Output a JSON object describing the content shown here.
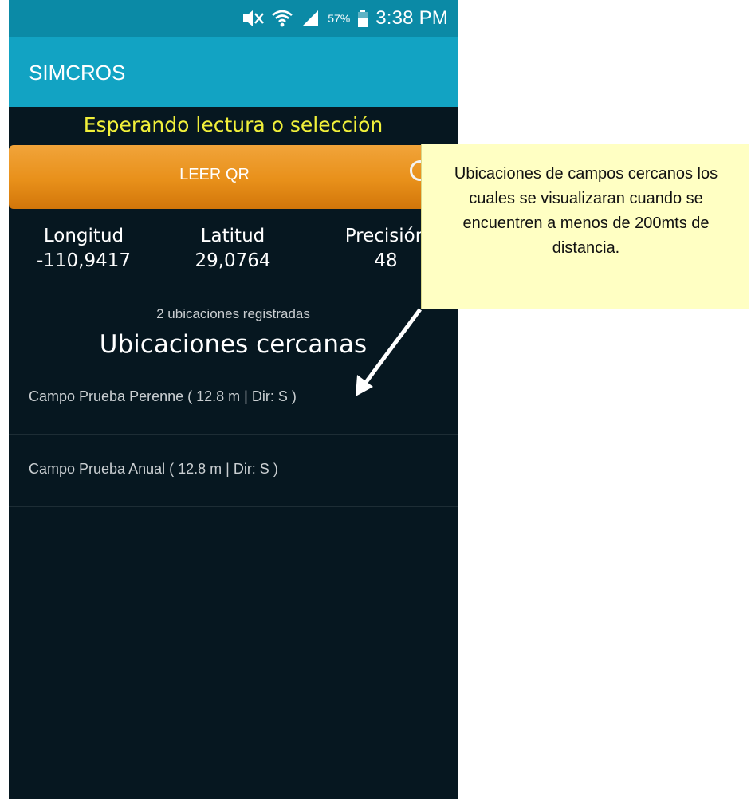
{
  "status_bar": {
    "battery_percent": "57%",
    "time": "3:38 PM",
    "icons": [
      "mute-icon",
      "wifi-icon",
      "signal-icon",
      "battery-icon"
    ]
  },
  "app_bar": {
    "title": "SIMCROS"
  },
  "status_message": "Esperando lectura o selección",
  "scan_button": {
    "label": "LEER QR",
    "icon": "target-circle-icon"
  },
  "coordinates": {
    "longitude": {
      "label": "Longitud",
      "value": "-110,9417"
    },
    "latitude": {
      "label": "Latitud",
      "value": "29,0764"
    },
    "precision": {
      "label": "Precisión",
      "value": "48"
    }
  },
  "locations": {
    "count_text": "2 ubicaciones registradas",
    "title": "Ubicaciones cercanas",
    "items": [
      {
        "label": "Campo Prueba Perenne ( 12.8 m | Dir: S )"
      },
      {
        "label": "Campo Prueba Anual ( 12.8 m | Dir: S )"
      }
    ]
  },
  "callout": {
    "text": "Ubicaciones de campos cercanos los cuales se visualizaran cuando se encuentren a menos de 200mts de distancia."
  },
  "colors": {
    "status_bar": "#0b8aa6",
    "app_bar": "#12a3c3",
    "background": "#061720",
    "status_message": "#f1f03a",
    "button": "#e8901a",
    "callout": "#ffffc3"
  }
}
